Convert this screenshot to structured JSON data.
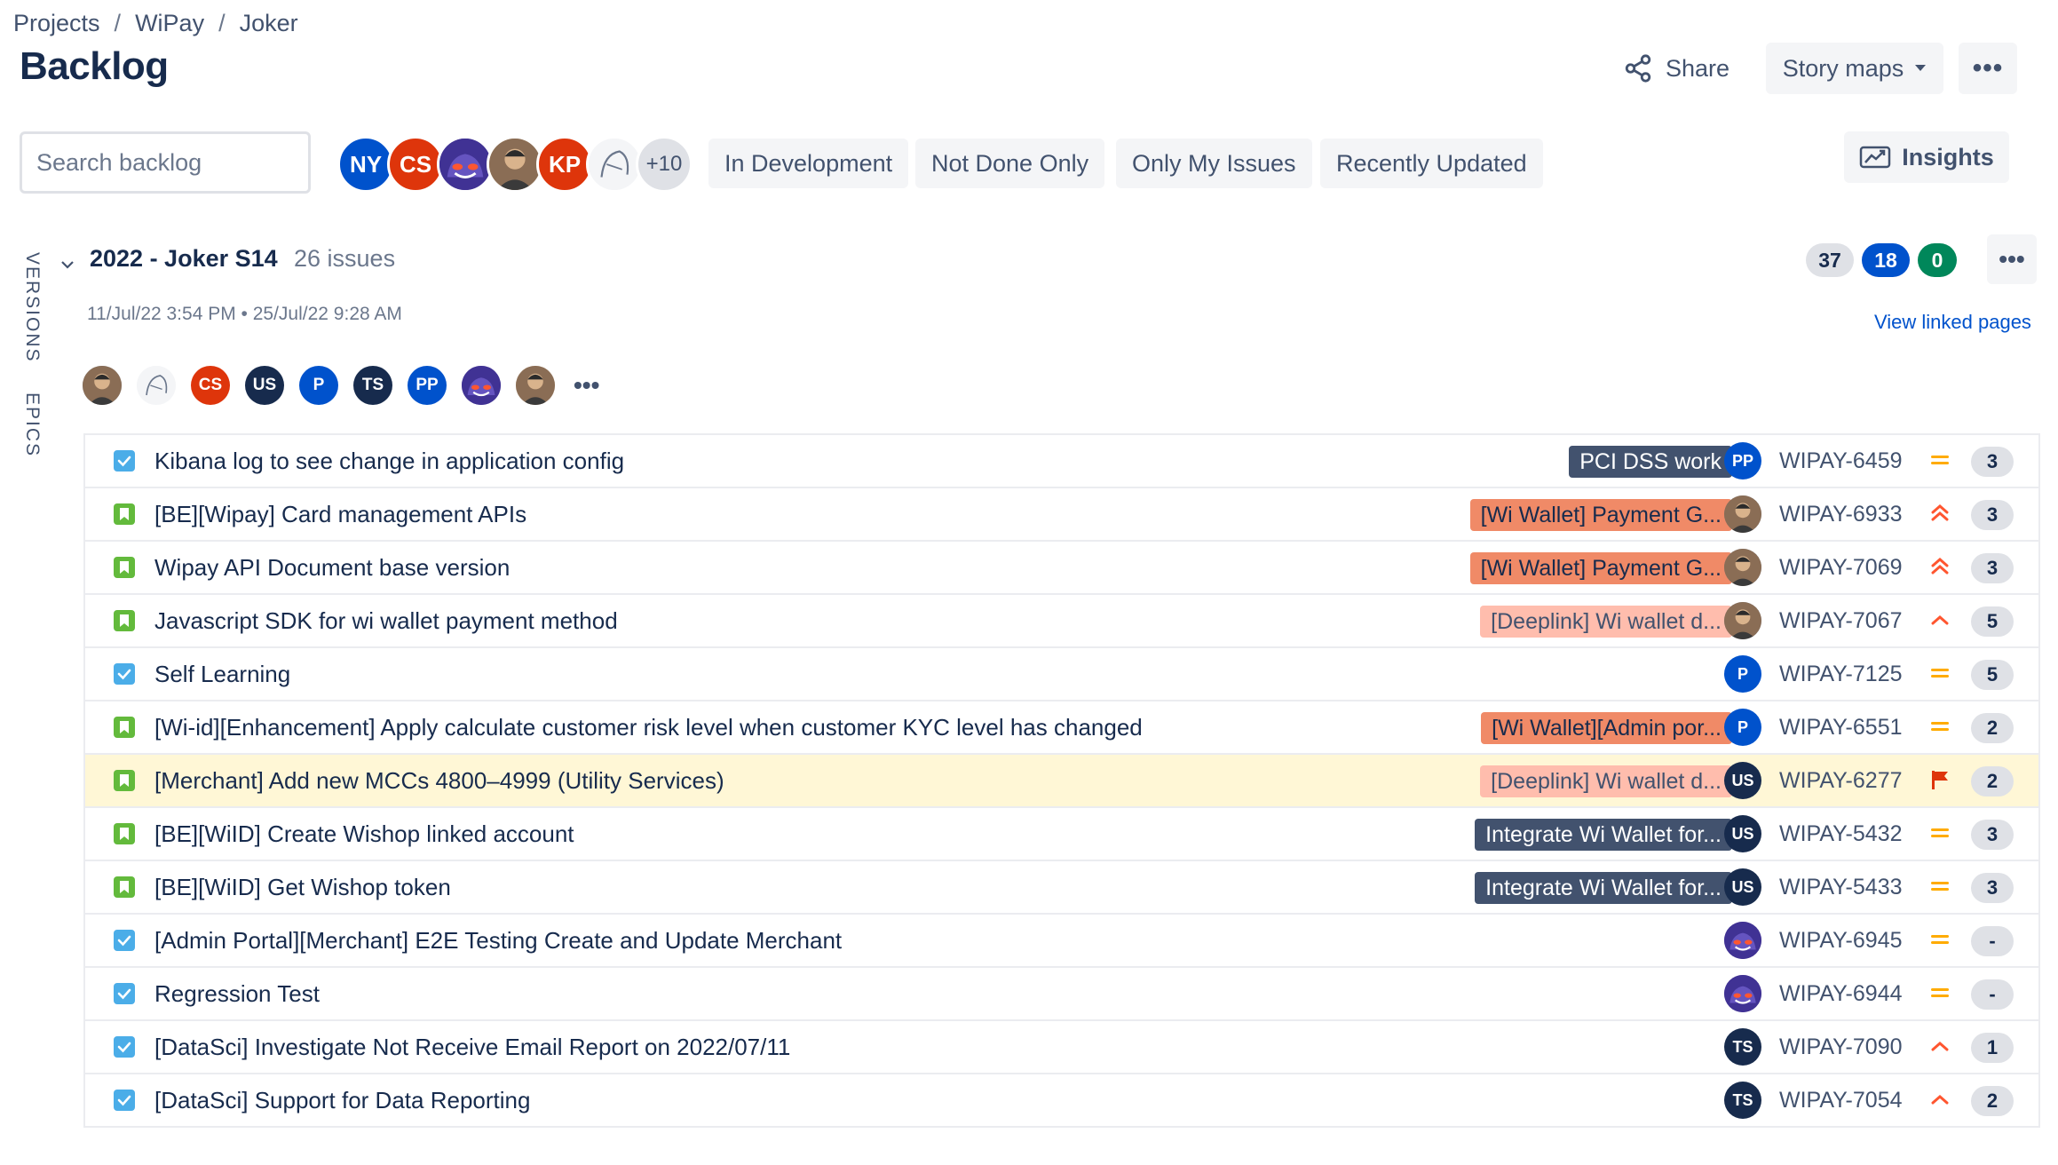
{
  "breadcrumb": [
    "Projects",
    "WiPay",
    "Joker"
  ],
  "page_title": "Backlog",
  "header": {
    "share_label": "Share",
    "story_maps_label": "Story maps"
  },
  "search": {
    "placeholder": "Search backlog",
    "value": ""
  },
  "avatars": [
    {
      "label": "NY",
      "color": "#0052cc"
    },
    {
      "label": "CS",
      "color": "#de350b"
    },
    {
      "label": "",
      "color": "#403294",
      "icon": "gengar-avatar"
    },
    {
      "label": "",
      "color": "#c1a07a",
      "icon": "photo-avatar"
    },
    {
      "label": "KP",
      "color": "#de350b"
    },
    {
      "label": "",
      "color": "#f4f5f7",
      "icon": "sketch-avatar"
    },
    {
      "label": "+10",
      "color": "#dfe1e6"
    }
  ],
  "filters": [
    "In Development",
    "Not Done Only",
    "Only My Issues",
    "Recently Updated"
  ],
  "insights_label": "Insights",
  "side_tabs": {
    "versions": "VERSIONS",
    "epics": "EPICS"
  },
  "sprint": {
    "name": "2022 - Joker S14",
    "issue_count": "26 issues",
    "dates": "11/Jul/22 3:54 PM  •  25/Jul/22 9:28 AM",
    "counts": {
      "todo": "37",
      "in_progress": "18",
      "done": "0"
    },
    "view_linked": "View linked pages",
    "members": [
      {
        "label": "",
        "color": "#6b778c",
        "icon": "photo-avatar"
      },
      {
        "label": "",
        "color": "#f4f5f7",
        "icon": "sketch-avatar"
      },
      {
        "label": "CS",
        "color": "#de350b"
      },
      {
        "label": "US",
        "color": "#172b4d"
      },
      {
        "label": "P",
        "color": "#0052cc"
      },
      {
        "label": "TS",
        "color": "#172b4d"
      },
      {
        "label": "PP",
        "color": "#0052cc"
      },
      {
        "label": "",
        "color": "#403294",
        "icon": "gengar-avatar"
      },
      {
        "label": "",
        "color": "#c1a07a",
        "icon": "photo-avatar"
      }
    ]
  },
  "issues": [
    {
      "type": "task",
      "summary": "Kibana log to see change in application config",
      "epic": "PCI DSS work",
      "epic_style": "dark",
      "assignee": "PP",
      "assignee_color": "#0052cc",
      "key": "WIPAY-6459",
      "priority": "medium",
      "estimate": "3",
      "highlight": false
    },
    {
      "type": "story",
      "summary": "[BE][Wipay] Card management APIs",
      "epic": "[Wi Wallet] Payment G...",
      "epic_style": "orange",
      "assignee": "",
      "assignee_color": "#6b778c",
      "key": "WIPAY-6933",
      "priority": "highest",
      "estimate": "3",
      "highlight": false
    },
    {
      "type": "story",
      "summary": "Wipay API Document base version",
      "epic": "[Wi Wallet] Payment G...",
      "epic_style": "orange",
      "assignee": "",
      "assignee_color": "#6b778c",
      "key": "WIPAY-7069",
      "priority": "highest",
      "estimate": "3",
      "highlight": false
    },
    {
      "type": "story",
      "summary": "Javascript SDK for wi wallet payment method",
      "epic": "[Deeplink] Wi wallet d...",
      "epic_style": "peach",
      "assignee": "",
      "assignee_color": "#6b778c",
      "key": "WIPAY-7067",
      "priority": "high",
      "estimate": "5",
      "highlight": false
    },
    {
      "type": "task",
      "summary": "Self Learning",
      "epic": "",
      "epic_style": "",
      "assignee": "P",
      "assignee_color": "#0052cc",
      "key": "WIPAY-7125",
      "priority": "medium",
      "estimate": "5",
      "highlight": false
    },
    {
      "type": "story",
      "summary": "[Wi-id][Enhancement] Apply calculate customer risk level when customer KYC level has changed",
      "epic": "[Wi Wallet][Admin por...",
      "epic_style": "orange",
      "assignee": "P",
      "assignee_color": "#0052cc",
      "key": "WIPAY-6551",
      "priority": "medium",
      "estimate": "2",
      "highlight": false
    },
    {
      "type": "story",
      "summary": "[Merchant] Add new MCCs 4800–4999 (Utility Services)",
      "epic": "[Deeplink] Wi wallet d...",
      "epic_style": "peach",
      "assignee": "US",
      "assignee_color": "#172b4d",
      "key": "WIPAY-6277",
      "priority": "flag",
      "estimate": "2",
      "highlight": true
    },
    {
      "type": "story",
      "summary": "[BE][WiID] Create Wishop linked account",
      "epic": "Integrate Wi Wallet for...",
      "epic_style": "dark",
      "assignee": "US",
      "assignee_color": "#172b4d",
      "key": "WIPAY-5432",
      "priority": "medium",
      "estimate": "3",
      "highlight": false
    },
    {
      "type": "story",
      "summary": "[BE][WiID] Get Wishop token",
      "epic": "Integrate Wi Wallet for...",
      "epic_style": "dark",
      "assignee": "US",
      "assignee_color": "#172b4d",
      "key": "WIPAY-5433",
      "priority": "medium",
      "estimate": "3",
      "highlight": false
    },
    {
      "type": "task",
      "summary": "[Admin Portal][Merchant] E2E Testing Create and Update Merchant",
      "epic": "",
      "epic_style": "",
      "assignee": "",
      "assignee_color": "#403294",
      "key": "WIPAY-6945",
      "priority": "medium",
      "estimate": "-",
      "highlight": false
    },
    {
      "type": "task",
      "summary": "Regression Test",
      "epic": "",
      "epic_style": "",
      "assignee": "",
      "assignee_color": "#403294",
      "key": "WIPAY-6944",
      "priority": "medium",
      "estimate": "-",
      "highlight": false
    },
    {
      "type": "task",
      "summary": "[DataSci] Investigate Not Receive Email Report on 2022/07/11",
      "epic": "",
      "epic_style": "",
      "assignee": "TS",
      "assignee_color": "#172b4d",
      "key": "WIPAY-7090",
      "priority": "high",
      "estimate": "1",
      "highlight": false
    },
    {
      "type": "task",
      "summary": "[DataSci] Support for Data Reporting",
      "epic": "",
      "epic_style": "",
      "assignee": "TS",
      "assignee_color": "#172b4d",
      "key": "WIPAY-7054",
      "priority": "high",
      "estimate": "2",
      "highlight": false
    }
  ]
}
